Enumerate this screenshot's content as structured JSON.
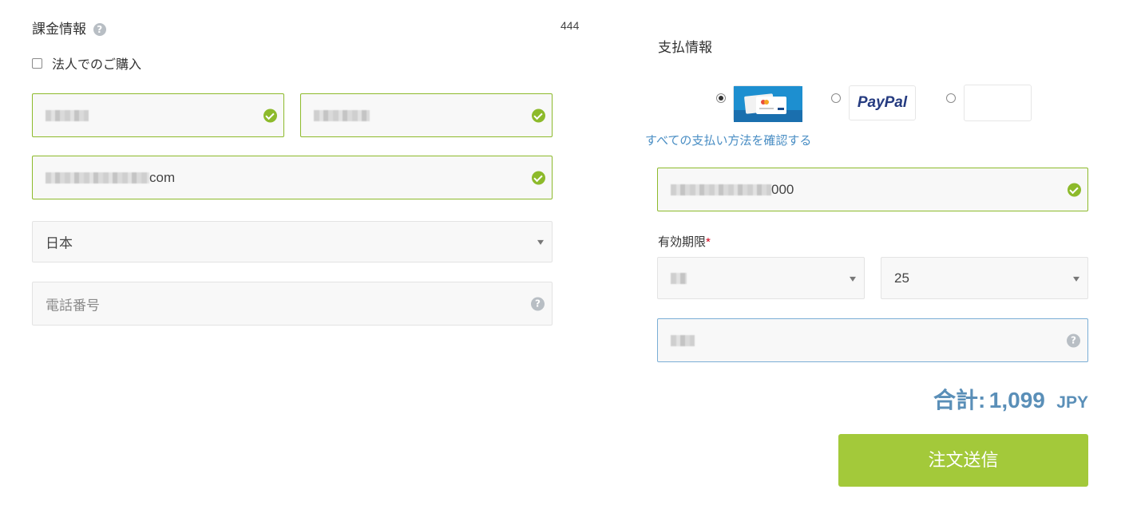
{
  "billing": {
    "title": "課金情報",
    "help_icon": "question-circle-icon",
    "counter": "444",
    "corporate_checkbox_label": "法人でのご購入",
    "corporate_checked": false,
    "first_name_value": "",
    "last_name_value": "",
    "email_value": "com",
    "country_value": "日本",
    "phone_placeholder": "電話番号"
  },
  "payment": {
    "title": "支払情報",
    "methods": [
      {
        "name": "credit-card",
        "selected": true
      },
      {
        "name": "PayPal",
        "label": "PayPal",
        "selected": false
      },
      {
        "name": "other",
        "selected": false
      }
    ],
    "all_methods_link": "すべての支払い方法を確認する",
    "card_number_value": "000",
    "expiry_label": "有効期限",
    "required_mark": "*",
    "expiry_month_value": "",
    "expiry_year_value": "25",
    "cvv_value": "",
    "total_label": "合計:",
    "total_amount": "1,099",
    "currency": "JPY",
    "submit_label": "注文送信"
  },
  "colors": {
    "valid_border": "#8dba2b",
    "focus_border": "#7aaed6",
    "link": "#4a8ec4",
    "total": "#5a8fb8",
    "submit": "#a3c93a"
  }
}
